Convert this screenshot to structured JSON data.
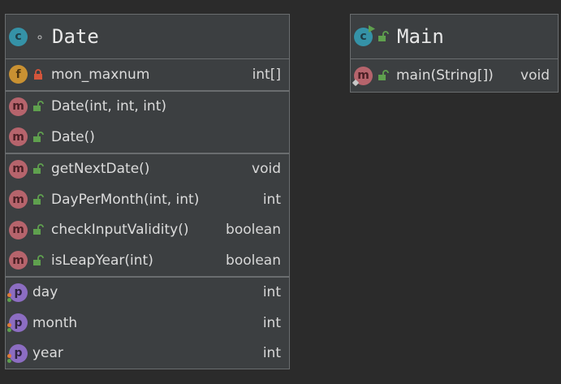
{
  "date_class": {
    "name": "Date",
    "fields": [
      {
        "name": "mon_maxnum",
        "type": "int[]",
        "badge": "f",
        "visibility": "private"
      }
    ],
    "constructors": [
      {
        "name": "Date(int, int, int)",
        "type": "",
        "badge": "m"
      },
      {
        "name": "Date()",
        "type": "",
        "badge": "m"
      }
    ],
    "methods": [
      {
        "name": "getNextDate()",
        "type": "void",
        "badge": "m"
      },
      {
        "name": "DayPerMonth(int, int)",
        "type": "int",
        "badge": "m"
      },
      {
        "name": "checkInputValidity()",
        "type": "boolean",
        "badge": "m"
      },
      {
        "name": "isLeapYear(int)",
        "type": "boolean",
        "badge": "m"
      }
    ],
    "properties": [
      {
        "name": "day",
        "type": "int",
        "badge": "p"
      },
      {
        "name": "month",
        "type": "int",
        "badge": "p"
      },
      {
        "name": "year",
        "type": "int",
        "badge": "p"
      }
    ]
  },
  "main_class": {
    "name": "Main",
    "methods": [
      {
        "name": "main(String[])",
        "type": "void",
        "badge": "m"
      }
    ]
  },
  "colors": {
    "background": "#2b2b2b",
    "node_fill": "#3c3f41",
    "class_badge": "#3592a7",
    "field_badge": "#c99132",
    "method_badge": "#b6646c",
    "property_badge": "#8c6dc2",
    "public_lock": "#5fa04e",
    "private_lock": "#d4553b"
  }
}
